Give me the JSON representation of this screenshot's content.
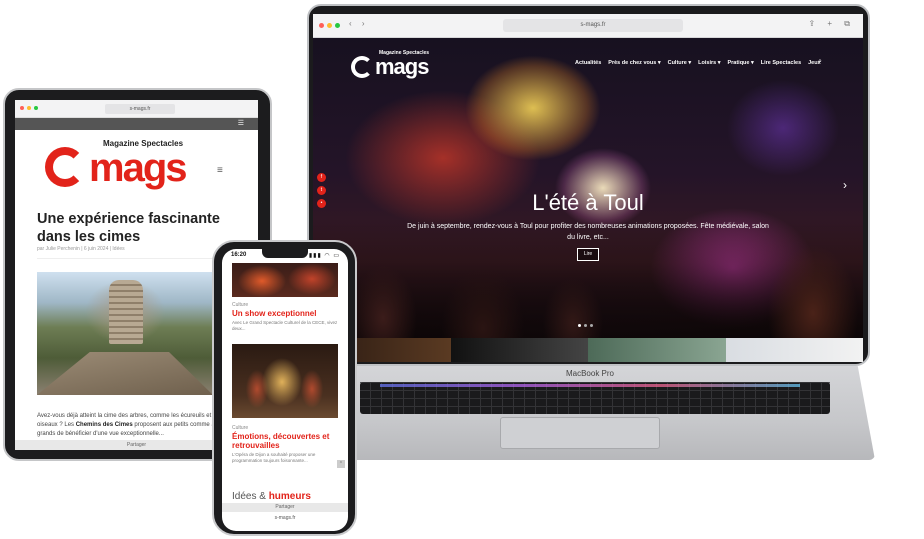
{
  "colors": {
    "brand_red": "#e2231a",
    "text_dark": "#222222",
    "text_muted": "#888888",
    "laptop_silver": "#c6c7ca"
  },
  "laptop": {
    "model_label": "MacBook Pro",
    "browser": {
      "url": "s-mags.fr"
    },
    "site": {
      "logo_word": "mags",
      "logo_tagline": "Magazine Spectacles",
      "menu": [
        "Actualités",
        "Près de chez vous ▾",
        "Culture ▾",
        "Loisirs ▾",
        "Pratique ▾",
        "Lire Spectacles",
        "Jeux"
      ],
      "search_icon": "search-icon",
      "social_icons": [
        "facebook-icon",
        "twitter-icon",
        "more-icon"
      ],
      "hero": {
        "title": "L'été à Toul",
        "subtitle": "De juin à septembre, rendez-vous à Toul pour profiter des nombreuses animations proposées. Fête médiévale, salon du livre, etc...",
        "button_label": "Lire",
        "next_icon": "chevron-right-icon"
      }
    }
  },
  "tablet": {
    "browser": {
      "url": "s-mags.fr"
    },
    "site": {
      "logo_word": "mags",
      "logo_tagline": "Magazine Spectacles",
      "menu_icon": "hamburger-icon",
      "article": {
        "title": "Une expérience fascinante dans les cimes",
        "meta": "par Julie Perchenin | 6 juin 2024 | Idées",
        "body_start": "Avez-vous déjà atteint la cime des arbres, comme les écureuils et les oiseaux ? Les ",
        "body_bold": "Chemins des Cimes",
        "body_end": " proposent aux petits comme aux grands de bénéficier d'une vue exceptionnelle..."
      },
      "share_label": "Partager"
    }
  },
  "phone": {
    "status_time": "16:20",
    "status_icons": "▮▮▮ ◠ ▭",
    "articles": [
      {
        "category": "Culture",
        "title": "Un show exceptionnel",
        "excerpt": "Avec Le Grand Spectacle Culturel de la CECE, vivez deux..."
      },
      {
        "category": "Culture",
        "title": "Émotions, découvertes et retrouvailles",
        "excerpt": "L'Opéra de Dijon a souhaité proposer une programmation toujours foisonnante..."
      }
    ],
    "section_light": "Idées & ",
    "section_bold": "humeurs",
    "share_label": "Partager",
    "url": "s-mags.fr"
  }
}
